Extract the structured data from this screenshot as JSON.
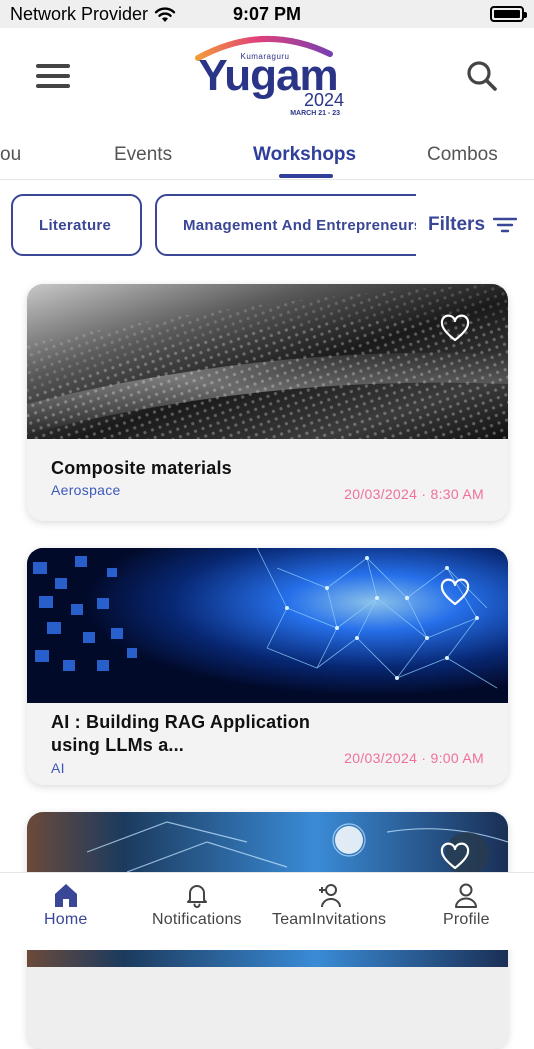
{
  "status_bar": {
    "provider": "Network Provider",
    "time": "9:07 PM"
  },
  "logo": {
    "small_text": "Kumaraguru",
    "brand": "Yugam",
    "year": "2024",
    "dates": "MARCH 21 - 23"
  },
  "tabs": [
    {
      "label": "ou"
    },
    {
      "label": "Events"
    },
    {
      "label": "Workshops",
      "active": true
    },
    {
      "label": "Combos"
    }
  ],
  "chips": [
    {
      "label": "Literature"
    },
    {
      "label": "Management And Entrepreneurship"
    }
  ],
  "filters_label": "Filters",
  "cards": [
    {
      "title": "Composite materials",
      "category": "Aerospace",
      "datetime": "20/03/2024 · 8:30 AM"
    },
    {
      "title": "AI : Building RAG Application using LLMs a...",
      "category": "AI",
      "datetime": "20/03/2024 · 9:00 AM"
    },
    {
      "title": "",
      "category": "",
      "datetime": ""
    }
  ],
  "bottom_nav": [
    {
      "label": "Home",
      "icon": "home-icon",
      "active": true
    },
    {
      "label": "Notifications",
      "icon": "bell-icon"
    },
    {
      "label": "TeamInvitations",
      "icon": "add-user-icon"
    },
    {
      "label": "Profile",
      "icon": "user-icon"
    }
  ],
  "colors": {
    "accent": "#2f3f9a",
    "date": "#f07099",
    "category": "#3d59b8"
  }
}
